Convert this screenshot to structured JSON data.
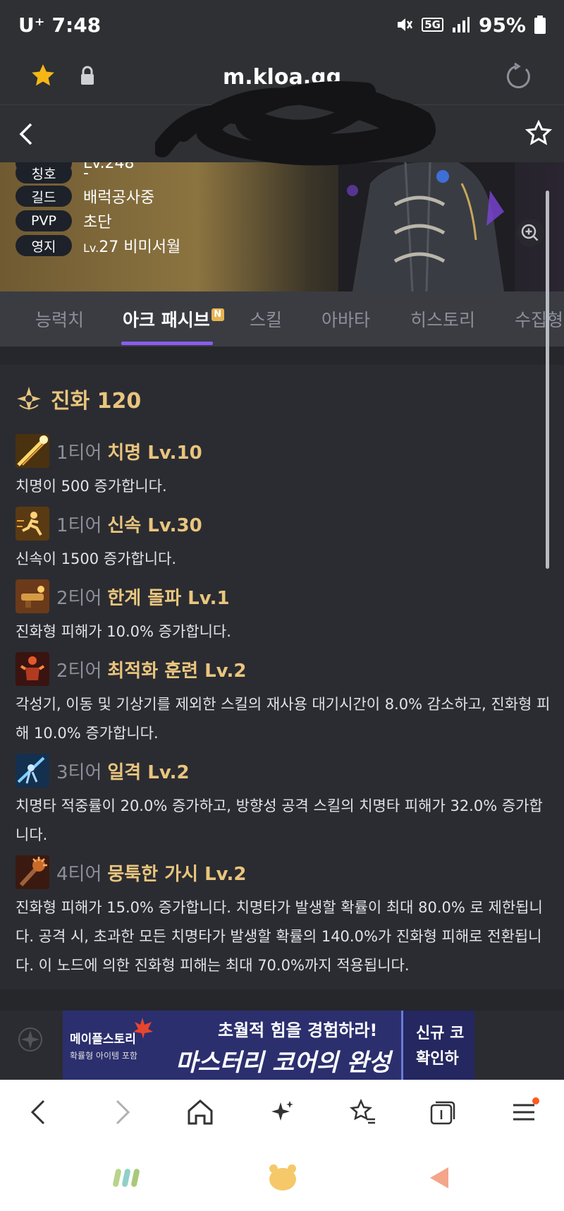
{
  "status_bar": {
    "carrier": "U⁺",
    "time": "7:48",
    "network": "5G",
    "battery": "95%"
  },
  "browser": {
    "url": "m.kloa.gg"
  },
  "profile": {
    "partial_row_value": "Lv.248",
    "rows": [
      {
        "label": "칭호",
        "value": "-"
      },
      {
        "label": "길드",
        "value": "배럭공사중"
      },
      {
        "label": "PVP",
        "value": "초단"
      },
      {
        "label": "영지",
        "value_prefix": "Lv.",
        "value": "27 비미서월"
      }
    ]
  },
  "tabs": [
    {
      "label": "능력치"
    },
    {
      "label": "아크 패시브",
      "badge": "N",
      "active": true
    },
    {
      "label": "스킬"
    },
    {
      "label": "아바타"
    },
    {
      "label": "히스토리"
    },
    {
      "label": "수집형"
    }
  ],
  "section": {
    "title": "진화 120"
  },
  "entries": [
    {
      "tier": "1티어",
      "name": "치명 Lv.10",
      "desc": "치명이 500 증가합니다.",
      "icon": "crit-icon"
    },
    {
      "tier": "1티어",
      "name": "신속 Lv.30",
      "desc": "신속이 1500 증가합니다.",
      "icon": "swiftness-icon"
    },
    {
      "tier": "2티어",
      "name": "한계 돌파 Lv.1",
      "desc": "진화형 피해가 10.0% 증가합니다.",
      "icon": "limit-break-icon"
    },
    {
      "tier": "2티어",
      "name": "최적화 훈련 Lv.2",
      "desc": "각성기, 이동 및 기상기를 제외한 스킬의 재사용 대기시간이 8.0% 감소하고, 진화형 피해 10.0% 증가합니다.",
      "icon": "training-icon"
    },
    {
      "tier": "3티어",
      "name": "일격 Lv.2",
      "desc": "치명타 적중률이 20.0% 증가하고, 방향성 공격 스킬의 치명타 피해가 32.0% 증가합니다.",
      "icon": "strike-icon"
    },
    {
      "tier": "4티어",
      "name": "뭉툭한 가시 Lv.2",
      "desc": "진화형 피해가 15.0% 증가합니다. 치명타가 발생할 확률이 최대 80.0% 로 제한됩니다. 공격 시, 초과한 모든 치명타가 발생할 확률의 140.0%가 진화형 피해로 전환됩니다. 이 노드에 의한 진화형 피해는 최대 70.0%까지 적용됩니다.",
      "icon": "blunt-thorn-icon"
    }
  ],
  "ad": {
    "brand_line1": "메이플스토리",
    "brand_line2": "확률형 아이템 포함",
    "headline": "초월적 힘을 경험하라!",
    "main": "마스터리 코어의 완성",
    "side_line1": "신규 코",
    "side_line2": "확인하"
  },
  "colors": {
    "accent": "#8a5cf5",
    "gold": "#e9c57e",
    "background": "#2b2c31"
  }
}
